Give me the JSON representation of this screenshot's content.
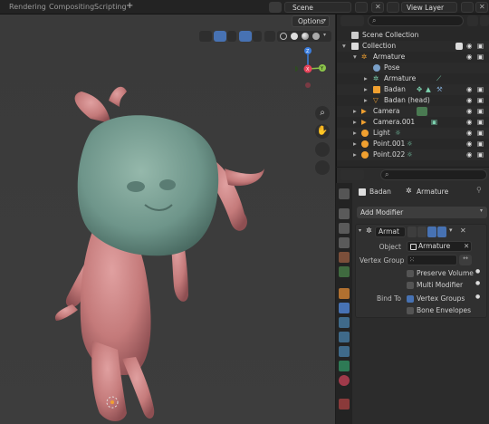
{
  "workspace_tabs": [
    "Rendering",
    "Compositing",
    "Scripting"
  ],
  "add_tab": "+",
  "scene": {
    "label": "Scene"
  },
  "view_layer": {
    "label": "View Layer"
  },
  "viewport": {
    "options_label": "Options"
  },
  "gizmo": {
    "x": "X",
    "y": "Y",
    "z": "Z"
  },
  "outliner": {
    "rows": [
      {
        "label": "Scene Collection"
      },
      {
        "label": "Collection"
      },
      {
        "label": "Armature"
      },
      {
        "label": "Pose"
      },
      {
        "label": "Armature"
      },
      {
        "label": "Badan"
      },
      {
        "label": "Badan (head)"
      },
      {
        "label": "Camera"
      },
      {
        "label": "Camera.001"
      },
      {
        "label": "Light"
      },
      {
        "label": "Point.001"
      },
      {
        "label": "Point.022"
      }
    ]
  },
  "properties": {
    "breadcrumb_object": "Badan",
    "breadcrumb_modifier": "Armature",
    "add_modifier": "Add Modifier",
    "modifier_name": "Armat",
    "object_label": "Object",
    "object_value": "Armature",
    "vertex_group_label": "Vertex Group",
    "preserve_volume": "Preserve Volume",
    "multi_modifier": "Multi Modifier",
    "bind_to_label": "Bind To",
    "vertex_groups": "Vertex Groups",
    "bone_envelopes": "Bone Envelopes"
  },
  "colors": {
    "accent": "#4772b3",
    "axis_x": "#e8435a",
    "axis_y": "#8bc34a",
    "axis_z": "#3b7ddd",
    "mesh_body": "#c47a7a",
    "mesh_head": "#6e958a"
  }
}
